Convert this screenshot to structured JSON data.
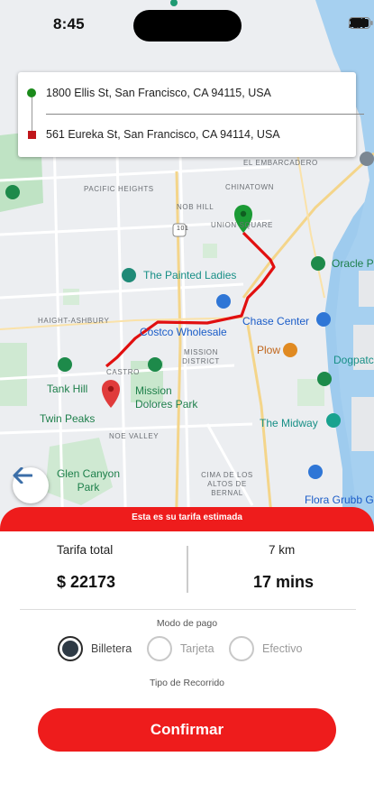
{
  "status_bar": {
    "time": "8:45"
  },
  "route": {
    "origin": "1800 Ellis St, San Francisco, CA 94115, USA",
    "destination": "561 Eureka St, San Francisco, CA 94114, USA"
  },
  "map": {
    "neighborhoods": [
      "EL EMBARCADERO",
      "PACIFIC HEIGHTS",
      "CHINATOWN",
      "NOB HILL",
      "UNION SQUARE",
      "HAIGHT-ASHBURY",
      "CASTRO",
      "MISSION DISTRICT",
      "NOE VALLEY",
      "CIMA DE LOS ALTOS DE BERNAL"
    ],
    "highway": "101",
    "pois": [
      "The Painted Ladies",
      "Oracle Pa",
      "Chase Center",
      "Costco Wholesale",
      "Plow",
      "Dogpatch Bo",
      "Tank Hill",
      "Mission Dolores Park",
      "Twin Peaks",
      "The Midway",
      "Glen Canyon Park",
      "Flora Grubb G"
    ],
    "route_color": "#e10f0f",
    "origin_pin_color": "#1b9a35",
    "destination_pin_color": "#e03b3b"
  },
  "sheet": {
    "banner": "Esta es su tarifa estimada",
    "fare_label": "Tarifa total",
    "fare_value": "$ 22173",
    "distance": "7 km",
    "duration": "17 mins",
    "payment_title": "Modo de pago",
    "payment_options": [
      {
        "label": "Billetera",
        "selected": true
      },
      {
        "label": "Tarjeta",
        "selected": false
      },
      {
        "label": "Efectivo",
        "selected": false
      }
    ],
    "trip_type_title": "Tipo de Recorrido",
    "confirm_label": "Confirmar"
  },
  "colors": {
    "accent": "#ee1c1c"
  }
}
